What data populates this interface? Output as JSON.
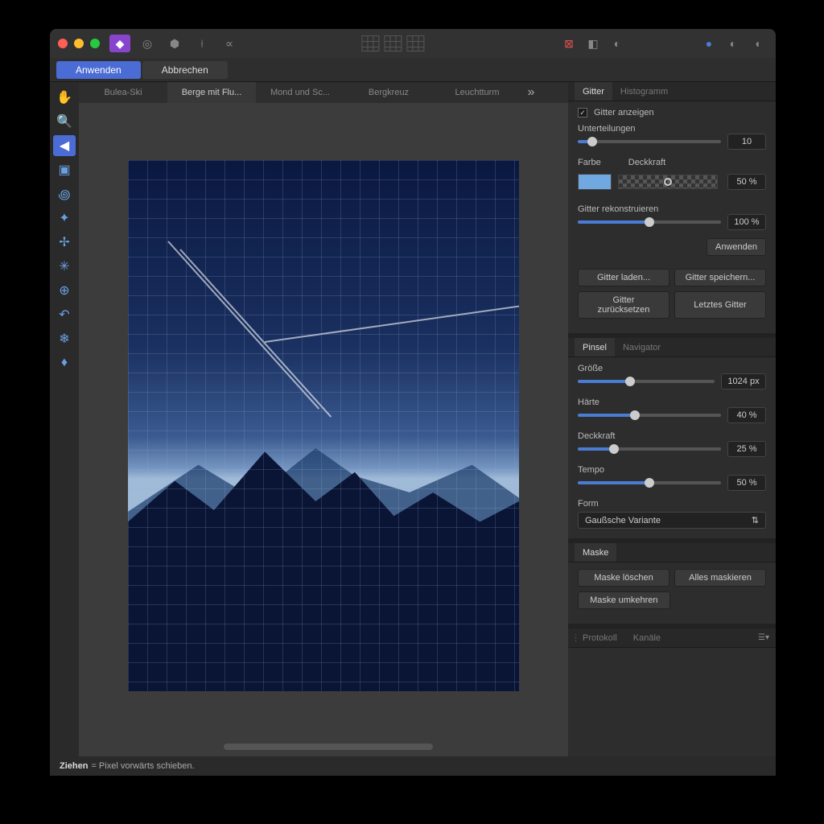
{
  "actions": {
    "apply": "Anwenden",
    "cancel": "Abbrechen"
  },
  "tabs": [
    "Bulea-Ski",
    "Berge mit Flu...",
    "Mond und Sc...",
    "Bergkreuz",
    "Leuchtturm"
  ],
  "active_tab_index": 1,
  "statusbar": {
    "verb": "Ziehen",
    "hint": "= Pixel vorwärts schieben."
  },
  "panel_gitter": {
    "tabs": [
      "Gitter",
      "Histogramm"
    ],
    "show_grid": {
      "label": "Gitter anzeigen",
      "checked": true
    },
    "subdivisions": {
      "label": "Unterteilungen",
      "value": "10",
      "percent": 10
    },
    "color_label": "Farbe",
    "opacity_label": "Deckkraft",
    "opacity_value": "50 %",
    "reconstruct": {
      "label": "Gitter rekonstruieren",
      "value": "100 %",
      "percent": 50
    },
    "apply_btn": "Anwenden",
    "buttons": {
      "load": "Gitter laden...",
      "save": "Gitter speichern...",
      "reset": "Gitter zurücksetzen",
      "last": "Letztes Gitter"
    }
  },
  "panel_pinsel": {
    "tabs": [
      "Pinsel",
      "Navigator"
    ],
    "size": {
      "label": "Größe",
      "value": "1024 px",
      "percent": 38
    },
    "hardness": {
      "label": "Härte",
      "value": "40 %",
      "percent": 40
    },
    "opacity": {
      "label": "Deckkraft",
      "value": "25 %",
      "percent": 25
    },
    "tempo": {
      "label": "Tempo",
      "value": "50 %",
      "percent": 50
    },
    "form": {
      "label": "Form",
      "value": "Gaußsche Variante"
    }
  },
  "panel_maske": {
    "tab": "Maske",
    "buttons": {
      "delete": "Maske löschen",
      "all": "Alles maskieren",
      "invert": "Maske umkehren"
    }
  },
  "panel_protokoll": {
    "tabs": [
      "Protokoll",
      "Kanäle"
    ]
  }
}
